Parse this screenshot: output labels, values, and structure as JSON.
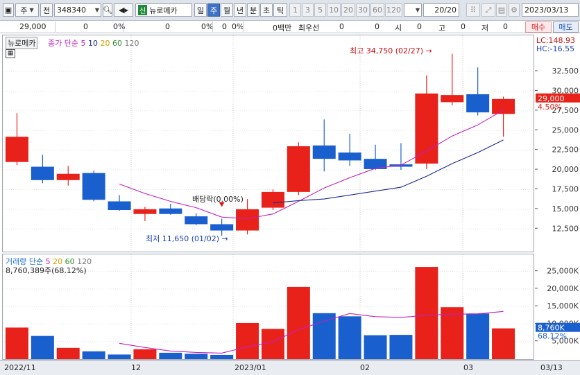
{
  "toolbar": {
    "market_type": "주",
    "mode_label": "전",
    "stock_code": "348340",
    "listing_badge": "신",
    "stock_name": "뉴로메카",
    "periods": [
      "일",
      "주",
      "월",
      "년",
      "분",
      "초",
      "틱"
    ],
    "active_period": "주",
    "intervals": [
      "1",
      "3",
      "5",
      "10",
      "20",
      "30",
      "60",
      "120"
    ],
    "count": "20/20",
    "date": "2023/03/13"
  },
  "quote": {
    "price": "29,000",
    "v1": "0",
    "v1_pct": "0%",
    "v2": "0",
    "v2_pct": "0%",
    "v3": "0",
    "v3_pct": "0%",
    "amount": "0백만",
    "priority_label": "최우선",
    "p1": "0",
    "p2": "0",
    "open_label": "시",
    "open": "0",
    "high_label": "고",
    "high": "0",
    "low_label": "저",
    "low": "0",
    "buy_label": "매수",
    "sell_label": "매도"
  },
  "price_pane": {
    "stock_name": "뉴로메카",
    "legend_prefix": "종가 단순",
    "ma_periods": [
      "5",
      "10",
      "20",
      "60",
      "120"
    ],
    "ma_colors": [
      "#c020c0",
      "#1a2a8c",
      "#d4a000",
      "#2e8b2e",
      "#777777"
    ],
    "lc": "LC:148.93",
    "hc": "HC:-16.55",
    "high_annotation": "최고 34,750 (02/27)",
    "low_annotation": "최저 11,650 (01/02)",
    "dividend_annotation": "배당락(0.00%)",
    "current_price": "29,000",
    "current_pct": "4.50%"
  },
  "volume_pane": {
    "legend_prefix": "거래량 단순",
    "ma_periods": [
      "5",
      "20",
      "60",
      "120"
    ],
    "ma_colors": [
      "#c020c0",
      "#d4a000",
      "#2e8b2e",
      "#777777"
    ],
    "current_volume": "8,760,389주(68.12%)",
    "current_tag": "8,760K",
    "current_pct": "68.12%"
  },
  "x_axis": {
    "labels": [
      "2022/11",
      "12",
      "2023/01",
      "02",
      "03",
      "03/13"
    ]
  },
  "colors": {
    "up": "#e8221a",
    "down": "#1a5fce",
    "ma5": "#c020c0",
    "ma10": "#1a2a8c"
  },
  "chart_data": {
    "type": "candlestick",
    "price_ticks": [
      12500,
      15000,
      17500,
      20000,
      22500,
      25000,
      27500,
      30000,
      32500
    ],
    "price_ylim": [
      10500,
      36200
    ],
    "volume_ticks": [
      "5,000K",
      "10,000K",
      "15,000K",
      "20,000K",
      "25,000K"
    ],
    "volume_tick_values": [
      5000,
      10000,
      15000,
      20000,
      25000
    ],
    "volume_ylim": [
      0,
      27500
    ],
    "candles": [
      {
        "o": 21000,
        "h": 27200,
        "l": 20600,
        "c": 24200,
        "v": 9000
      },
      {
        "o": 20400,
        "h": 21900,
        "l": 18300,
        "c": 18700,
        "v": 6600
      },
      {
        "o": 18700,
        "h": 20500,
        "l": 18000,
        "c": 19500,
        "v": 3200
      },
      {
        "o": 19600,
        "h": 19900,
        "l": 16000,
        "c": 16200,
        "v": 2200
      },
      {
        "o": 16000,
        "h": 16800,
        "l": 14800,
        "c": 14900,
        "v": 1300
      },
      {
        "o": 14400,
        "h": 15300,
        "l": 13500,
        "c": 15000,
        "v": 2800
      },
      {
        "o": 15100,
        "h": 15700,
        "l": 14300,
        "c": 14400,
        "v": 1800
      },
      {
        "o": 14100,
        "h": 14500,
        "l": 13000,
        "c": 13100,
        "v": 1500
      },
      {
        "o": 13100,
        "h": 13800,
        "l": 11650,
        "c": 12300,
        "v": 1200
      },
      {
        "o": 12300,
        "h": 16300,
        "l": 11800,
        "c": 15000,
        "v": 10300
      },
      {
        "o": 15200,
        "h": 17500,
        "l": 14900,
        "c": 17200,
        "v": 8600
      },
      {
        "o": 17200,
        "h": 23500,
        "l": 16800,
        "c": 23000,
        "v": 20600
      },
      {
        "o": 23100,
        "h": 26400,
        "l": 19800,
        "c": 21400,
        "v": 13100
      },
      {
        "o": 22200,
        "h": 24600,
        "l": 20500,
        "c": 21200,
        "v": 12200
      },
      {
        "o": 21400,
        "h": 23200,
        "l": 20000,
        "c": 20100,
        "v": 6800
      },
      {
        "o": 20700,
        "h": 23400,
        "l": 20000,
        "c": 20400,
        "v": 6900
      },
      {
        "o": 20800,
        "h": 32000,
        "l": 20100,
        "c": 29700,
        "v": 26300
      },
      {
        "o": 28600,
        "h": 34750,
        "l": 28200,
        "c": 29500,
        "v": 14800
      },
      {
        "o": 29600,
        "h": 33000,
        "l": 26900,
        "c": 27300,
        "v": 13000
      },
      {
        "o": 27100,
        "h": 29300,
        "l": 24200,
        "c": 29000,
        "v": 8760
      }
    ],
    "ma5": [
      null,
      null,
      null,
      null,
      18200,
      17000,
      16000,
      15200,
      14000,
      13800,
      14400,
      16000,
      17700,
      19000,
      20200,
      20600,
      22400,
      24300,
      25700,
      27600
    ],
    "ma10": [
      null,
      null,
      null,
      null,
      null,
      null,
      null,
      null,
      null,
      null,
      15800,
      16100,
      16300,
      16800,
      17300,
      17800,
      19200,
      20800,
      22200,
      23800
    ],
    "vol_ma5": [
      null,
      null,
      null,
      null,
      4500,
      3300,
      2300,
      1900,
      1700,
      3500,
      4900,
      8400,
      10800,
      13000,
      12100,
      11900,
      12500,
      12800,
      12900,
      13600
    ]
  }
}
